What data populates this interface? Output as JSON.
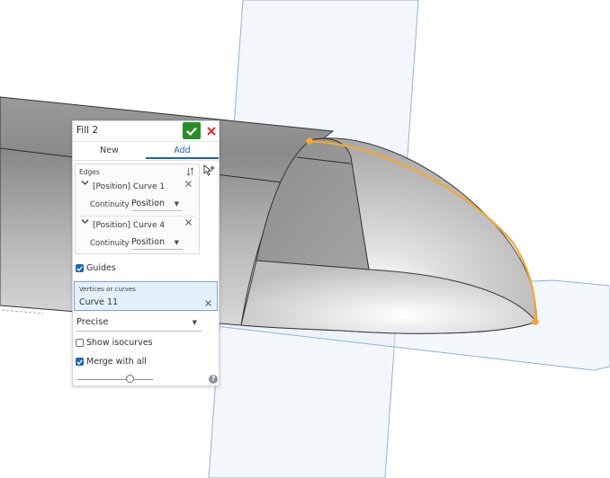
{
  "feature": {
    "title": "Fill 2"
  },
  "tabs": {
    "new": "New",
    "add": "Add"
  },
  "edges": {
    "label": "Edges",
    "items": [
      {
        "label": "[Position] Curve 1",
        "continuity_label": "Continuity",
        "continuity_value": "Position"
      },
      {
        "label": "[Position] Curve 4",
        "continuity_label": "Continuity",
        "continuity_value": "Position"
      }
    ]
  },
  "guides": {
    "label": "Guides",
    "checked": true
  },
  "vertices": {
    "label": "Vertices or curves",
    "value": "Curve 11"
  },
  "precision": {
    "value": "Precise"
  },
  "options": {
    "show_isocurves": "Show isocurves",
    "show_isocurves_checked": false,
    "merge_with_all": "Merge with all",
    "merge_with_all_checked": true
  },
  "slider": {
    "position_fraction": 0.7
  },
  "colors": {
    "accent": "#1f63b5",
    "confirm": "#2a8c2a",
    "cancel": "#d0312d",
    "highlight_curve": "#f2a73a",
    "plane": "#7aa5d0"
  },
  "help": {
    "glyph": "?"
  }
}
